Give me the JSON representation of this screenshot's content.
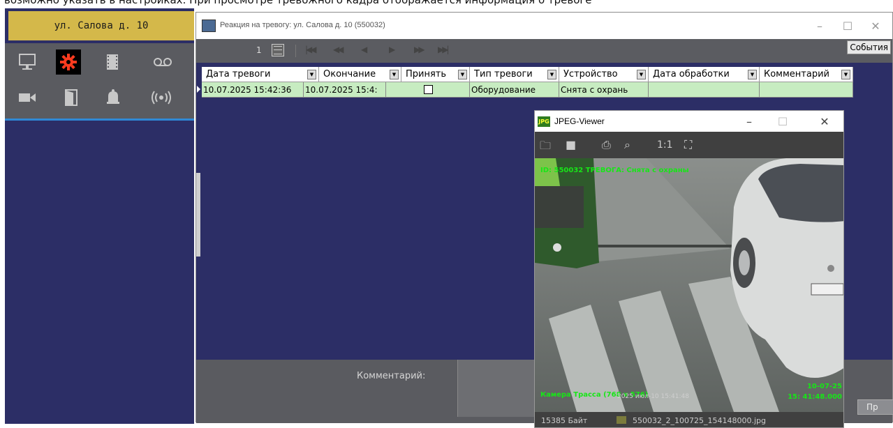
{
  "header_strip_text": "возможно указать в настройках. При просмотре тревожного кадра отображается информация о тревоге",
  "object_title": "ул. Салова д. 10",
  "icons": [
    "monitor-icon",
    "settings-gear-icon",
    "film-icon",
    "voicemail-icon",
    "video-camera-icon",
    "door-icon",
    "alarm-bell-icon",
    "radio-wave-icon"
  ],
  "alarm_window": {
    "title": "Реакция на тревогу: ул. Салова д. 10 (550032)",
    "page_number": "1",
    "events_button": "События",
    "columns": [
      "Дата тревоги",
      "Окончание",
      "Принять",
      "Тип тревоги",
      "Устройство",
      "Дата обработки",
      "Комментарий"
    ],
    "row": {
      "alarm_date": "10.07.2025 15:42:36",
      "end_date": "10.07.2025 15:4:",
      "accepted": false,
      "alarm_type": "Оборудование",
      "device": "Снята с охрань",
      "processed_date": "",
      "comment": ""
    },
    "comment_label": "Комментарий:",
    "process_button": "Пр"
  },
  "viewer": {
    "title": "JPEG-Viewer",
    "zoom_label": "1:1",
    "overlay_top": "ID: 550032  ТРЕВОГА: Снята с охраны",
    "overlay_camera": "Камера Трасса (768 x 576)",
    "overlay_time_small": "2025 июл-10 15:41:48",
    "overlay_date": "10-07-25",
    "overlay_time": "15: 41:48.000",
    "file_size": "15385 Байт",
    "file_name": "550032_2_100725_154148000.jpg"
  }
}
